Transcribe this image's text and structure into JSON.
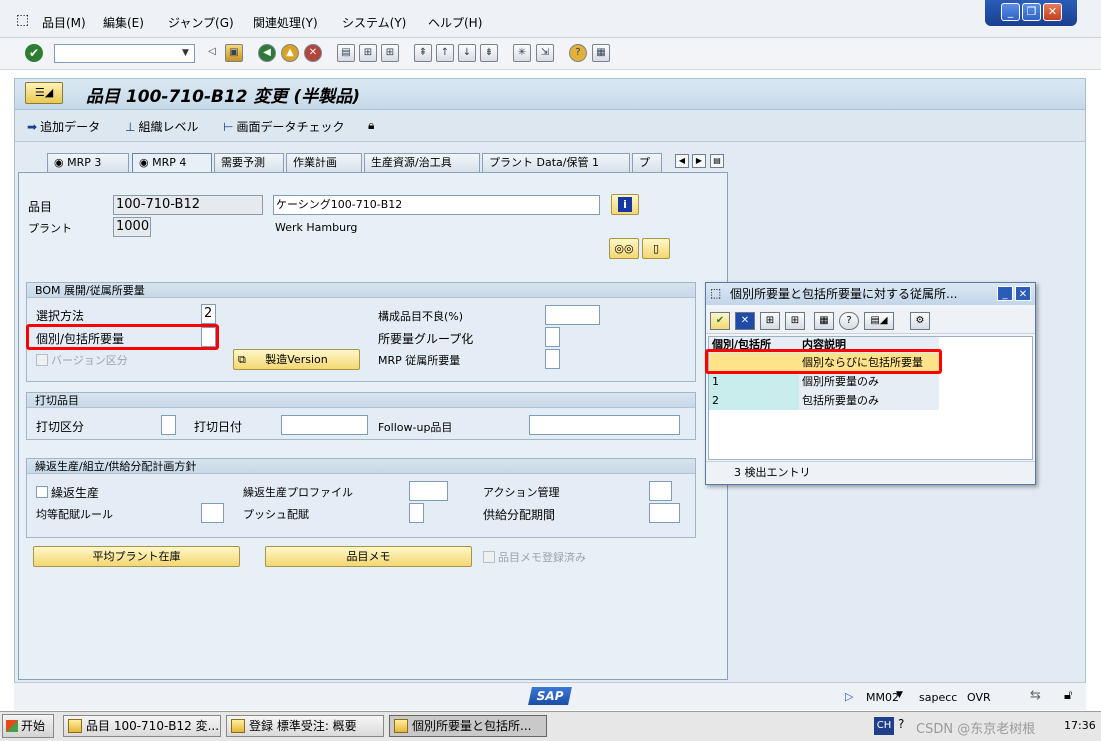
{
  "menu": {
    "items": [
      "品目(M)",
      "編集(E)",
      "ジャンプ(G)",
      "関連処理(Y)",
      "システム(Y)",
      "ヘルプ(H)"
    ]
  },
  "window_controls": {
    "minimize": "_",
    "restore": "❐",
    "close": "✕"
  },
  "title": {
    "text": "品目 100-710-B12 変更 (半製品)"
  },
  "app_toolbar": {
    "add_data": "追加データ",
    "org_level": "組織レベル",
    "check_screen_data": "画面データチェック"
  },
  "tabs": [
    "MRP 3",
    "MRP 4",
    "需要予測",
    "作業計画",
    "生産資源/治工具",
    "プラント Data/保管 1",
    "プ"
  ],
  "header": {
    "material_label": "品目",
    "material_value": "100-710-B12",
    "material_desc": "ケーシング100-710-B12",
    "plant_label": "プラント",
    "plant_value": "1000",
    "plant_name": "Werk Hamburg"
  },
  "bom_group": {
    "title": "BOM 展開/従属所要量",
    "selection_method_label": "選択方法",
    "selection_method_value": "2",
    "indiv_coll_label": "個別/包括所要量",
    "indiv_coll_value": "",
    "version_indicator_label": "バージョン区分",
    "prod_version_button": "製造Version",
    "component_scrap_label": "構成品目不良(%)",
    "component_scrap_value": "",
    "req_group_label": "所要量グループ化",
    "mrp_dep_req_label": "MRP 従属所要量"
  },
  "discontinued_group": {
    "title": "打切品目",
    "disc_ind_label": "打切区分",
    "eff_out_label": "打切日付",
    "followup_label": "Follow-up品目"
  },
  "repetitive_group": {
    "title": "繰返生産/組立/供給分配計画方針",
    "rep_mfg_label": "繰返生産",
    "rep_profile_label": "繰返生産プロファイル",
    "action_control_label": "アクション管理",
    "fair_share_label": "均等配賦ルール",
    "push_dist_label": "プッシュ配賦",
    "deployment_horizon_label": "供給分配期間"
  },
  "bottom_buttons": {
    "avg_plant_stock": "平均プラント在庫",
    "material_memo": "品目メモ",
    "memo_exists_label": "品目メモ登録済み"
  },
  "popup": {
    "title": "個別所要量と包括所要量に対する従属所...",
    "col_code": "個別/包括所",
    "col_desc": "内容説明",
    "rows": [
      {
        "code": "",
        "desc": "個別ならびに包括所要量"
      },
      {
        "code": "1",
        "desc": "個別所要量のみ"
      },
      {
        "code": "2",
        "desc": "包括所要量のみ"
      }
    ],
    "status": "3 検出エントリ"
  },
  "status_bar": {
    "sap_logo": "SAP",
    "transaction": "MM02",
    "server": "sapecc",
    "mode": "OVR"
  },
  "taskbar": {
    "start": "开始",
    "tasks": [
      "品目 100-710-B12 変...",
      "登録 標準受注: 概要",
      "個別所要量と包括所..."
    ],
    "ime": "CH",
    "watermark": "CSDN @东京老树根",
    "clock": "17:36"
  },
  "colors": {
    "highlight": "#ff0000",
    "selected_row": "#ffe38a",
    "code_cell": "#c9ecec"
  }
}
